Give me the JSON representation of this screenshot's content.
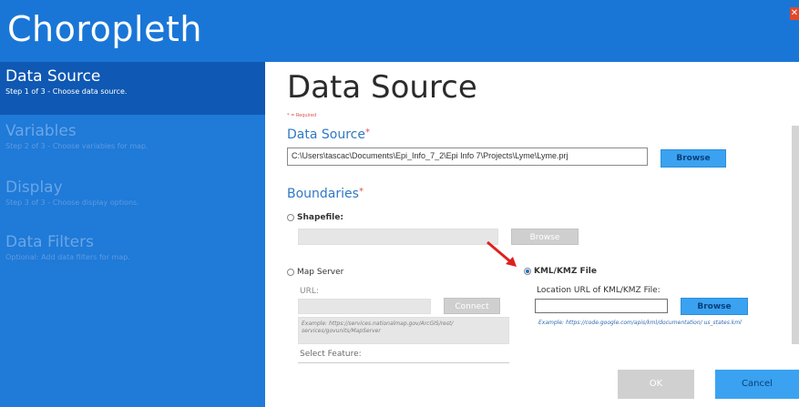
{
  "app": {
    "title": "Choropleth",
    "close_icon": "close-icon",
    "colors": {
      "header": "#1a76d6",
      "active_step": "#0f58b3",
      "accent_button": "#3aa2f0",
      "required": "#d9534f"
    }
  },
  "sidebar": {
    "steps": [
      {
        "title": "Data Source",
        "desc": "Step 1 of 3 - Choose data source.",
        "active": true
      },
      {
        "title": "Variables",
        "desc": "Step 2 of 3 - Choose variables for map.",
        "active": false
      },
      {
        "title": "Display",
        "desc": "Step 3 of 3 - Choose display options.",
        "active": false
      },
      {
        "title": "Data Filters",
        "desc": "Optional: Add data filters for map.",
        "active": false
      }
    ]
  },
  "main": {
    "page_title": "Data Source",
    "required_note": "* = Required",
    "data_source": {
      "label": "Data Source",
      "path_value": "C:\\Users\\tascac\\Documents\\Epi_Info_7_2\\Epi Info 7\\Projects\\Lyme\\Lyme.prj",
      "browse_label": "Browse"
    },
    "boundaries": {
      "label": "Boundaries",
      "shapefile": {
        "label": "Shapefile:",
        "browse_label": "Browse"
      },
      "map_server": {
        "label": "Map Server",
        "url_label": "URL:",
        "connect_label": "Connect",
        "example": "Example: https://services.nationalmap.gov/ArcGIS/rest/ services/govunits/MapServer",
        "select_feature_label": "Select Feature:"
      },
      "kml": {
        "label": "KML/KMZ File",
        "location_label": "Location URL of KML/KMZ File:",
        "browse_label": "Browse",
        "example": "Example: https://code.google.com/apis/kml/documentation/ us_states.kml"
      }
    },
    "ok_label": "OK",
    "cancel_label": "Cancel"
  }
}
